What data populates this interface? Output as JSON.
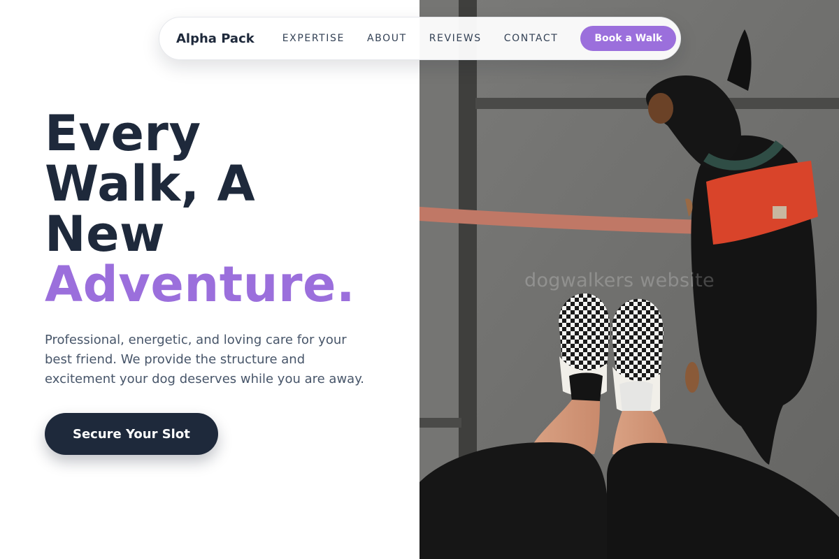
{
  "nav": {
    "brand": "Alpha Pack",
    "links": [
      "EXPERTISE",
      "ABOUT",
      "REVIEWS",
      "CONTACT"
    ],
    "cta_label": "Book a Walk"
  },
  "hero": {
    "headline_lines": [
      "Every",
      "Walk, A",
      "New"
    ],
    "headline_accent": "Adventure.",
    "subtitle": "Professional, energetic, and loving care for your best friend. We provide the structure and excitement your dog deserves while you are away.",
    "cta_label": "Secure Your Slot"
  },
  "photo": {
    "watermark": "dogwalkers website",
    "subject": "overhead photo of checkered sneakers next to a black dachshund in a red harness on a leash"
  },
  "colors": {
    "accent": "#9b6fdc",
    "navy": "#1e293b",
    "body_text": "#475569"
  }
}
